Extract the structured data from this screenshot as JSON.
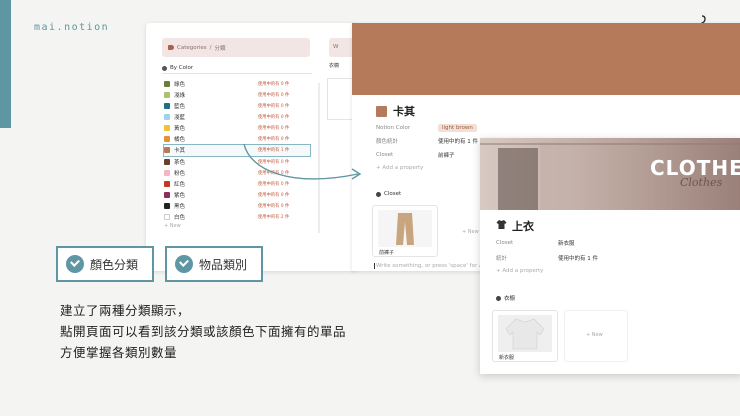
{
  "brand": "mai.notion",
  "left_panel": {
    "categories_label": "Categories",
    "categories_sub": "分類",
    "side_tab": "W",
    "side_tab2": "衣櫥",
    "view_label": "By Color",
    "colors": [
      {
        "name": "綠色",
        "count": "使用中的有 0 件",
        "swatch": "#6b7f3a"
      },
      {
        "name": "淺綠",
        "count": "使用中的有 0 件",
        "swatch": "#a9c46c"
      },
      {
        "name": "藍色",
        "count": "使用中的有 0 件",
        "swatch": "#1f6f8b"
      },
      {
        "name": "淺藍",
        "count": "使用中的有 0 件",
        "swatch": "#9fd3e6"
      },
      {
        "name": "黃色",
        "count": "使用中的有 0 件",
        "swatch": "#f1c232"
      },
      {
        "name": "橘色",
        "count": "使用中的有 0 件",
        "swatch": "#e69138"
      },
      {
        "name": "卡其",
        "count": "使用中的有 1 件",
        "swatch": "#b57a5a"
      },
      {
        "name": "茶色",
        "count": "使用中的有 0 件",
        "swatch": "#6d3f2a"
      },
      {
        "name": "粉色",
        "count": "使用中的有 0 件",
        "swatch": "#f4b6c2"
      },
      {
        "name": "紅色",
        "count": "使用中的有 0 件",
        "swatch": "#c0392b"
      },
      {
        "name": "紫色",
        "count": "使用中的有 0 件",
        "swatch": "#8e2c5b"
      },
      {
        "name": "黑色",
        "count": "使用中的有 0 件",
        "swatch": "#222222"
      },
      {
        "name": "白色",
        "count": "使用中的有 2 件",
        "swatch": "#ffffff"
      }
    ],
    "selected_index": 6,
    "new_label": "+ New"
  },
  "mid_panel": {
    "title": "卡其",
    "props": [
      {
        "label": "Notion Color",
        "value": "light brown"
      },
      {
        "label": "顏色統計",
        "value": "使用中的有 1 件"
      },
      {
        "label": "Closet",
        "value": "前褲子"
      }
    ],
    "add_property": "+ Add a property",
    "section": "Closet",
    "card_caption": "前褲子",
    "new_label": "+ New",
    "write_hint": "Write something, or press 'space' for AI, '/' fo"
  },
  "front_panel": {
    "cover_word": "CLOTHES",
    "cover_script": "Clothes",
    "title": "上衣",
    "props": [
      {
        "label": "Closet",
        "value": "新衣服"
      },
      {
        "label": "統計",
        "value": "使用中的有 1 件"
      }
    ],
    "add_property": "+ Add a property",
    "section": "衣櫥",
    "card_caption": "新衣服",
    "new_label": "+ New"
  },
  "badges": [
    {
      "label": "顏色分類"
    },
    {
      "label": "物品類別"
    }
  ],
  "caption": [
    "建立了兩種分類顯示，",
    "點開頁面可以看到該分類或該顏色下面擁有的單品",
    "方便掌握各類別數量"
  ],
  "colors": {
    "accent": "#5f96a3",
    "khaki": "#b57a5a",
    "count_red": "#c05a3c"
  }
}
